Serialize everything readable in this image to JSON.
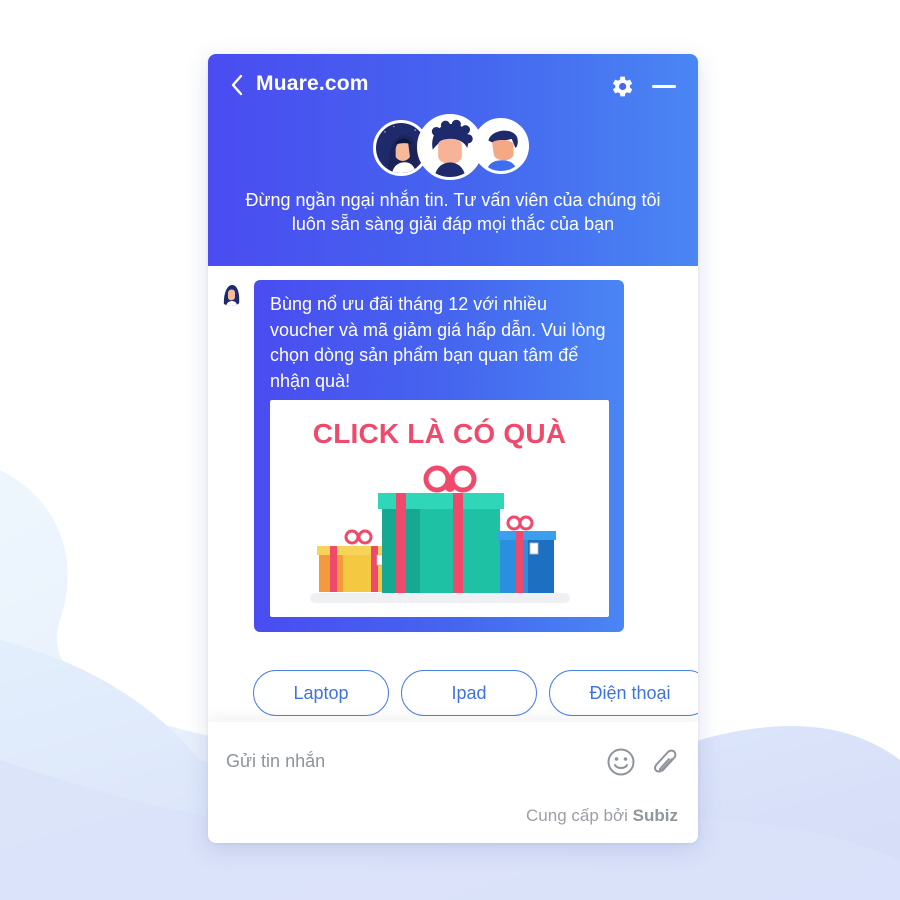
{
  "header": {
    "title": "Muare.com",
    "back_icon": "chevron-left-icon",
    "settings_icon": "gear-icon",
    "minimize_icon": "minimize-icon",
    "intro": "Đừng ngần ngại nhắn tin. Tư vấn viên của chúng tôi luôn sẵn sàng giải đáp mọi thắc của bạn"
  },
  "message": {
    "text": "Bùng nổ ưu đãi tháng 12 với nhiều voucher và mã giảm giá hấp dẫn. Vui lòng chọn dòng sản phẩm bạn quan tâm để nhận quà!",
    "promo_title": "CLICK LÀ CÓ QUÀ"
  },
  "quick_replies": [
    "Laptop",
    "Ipad",
    "Điện thoại"
  ],
  "composer": {
    "placeholder": "Gửi tin nhắn",
    "emoji_icon": "smiley-icon",
    "attach_icon": "paperclip-icon",
    "powered_by_prefix": "Cung cấp bởi",
    "powered_by_brand": "Subiz"
  },
  "colors": {
    "header_gradient_start": "#4a4cf0",
    "header_gradient_end": "#4a86f4",
    "quick_reply": "#3f73e2",
    "promo_title": "#ef4a6b"
  }
}
